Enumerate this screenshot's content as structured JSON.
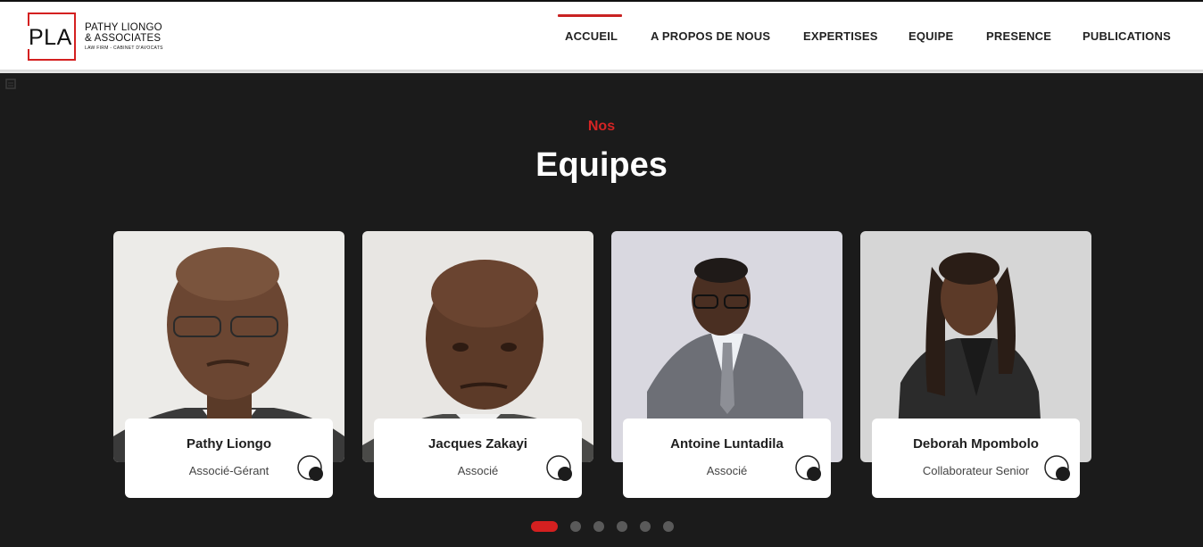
{
  "brand": {
    "logo_mark": "PLA",
    "name_line1": "PATHY LIONGO",
    "name_line2": "& ASSOCIATES",
    "tagline": "LAW FIRM - CABINET D'AVOCATS",
    "accent_color": "#d42020"
  },
  "nav": {
    "items": [
      {
        "label": "ACCUEIL",
        "active": true
      },
      {
        "label": "A PROPOS DE NOUS"
      },
      {
        "label": "EXPERTISES"
      },
      {
        "label": "EQUIPE"
      },
      {
        "label": "PRESENCE"
      },
      {
        "label": "PUBLICATIONS"
      }
    ]
  },
  "section": {
    "subtitle": "Nos",
    "title": "Equipes"
  },
  "team": [
    {
      "name": "Pathy Liongo",
      "role": "Associé-Gérant",
      "icon": "toggle-circle-icon"
    },
    {
      "name": "Jacques Zakayi",
      "role": "Associé",
      "icon": "toggle-circle-icon"
    },
    {
      "name": "Antoine Luntadila",
      "role": "Associé",
      "icon": "toggle-circle-icon"
    },
    {
      "name": "Deborah Mpombolo",
      "role": "Collaborateur Senior",
      "icon": "toggle-circle-icon"
    }
  ],
  "pagination": {
    "total": 6,
    "current": 1
  }
}
